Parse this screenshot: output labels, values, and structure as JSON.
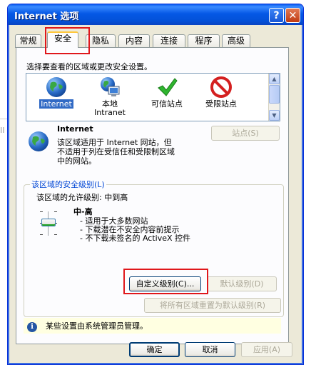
{
  "window": {
    "title": "Internet 选项"
  },
  "tabs": [
    "常规",
    "安全",
    "隐私",
    "内容",
    "连接",
    "程序",
    "高级"
  ],
  "zones": {
    "prompt": "选择要查看的区域或更改安全设置。",
    "items": [
      {
        "label": "Internet",
        "selected": true
      },
      {
        "label": "本地\nIntranet",
        "selected": false
      },
      {
        "label": "可信站点",
        "selected": false
      },
      {
        "label": "受限站点",
        "selected": false
      }
    ]
  },
  "zone_info": {
    "name": "Internet",
    "description": "该区域适用于 Internet 网站，但\n不适用于列在受信任和受限制区域\n中的网站。",
    "sites_button": "站点(S)"
  },
  "security_level": {
    "group_title": "该区域的安全级别(L)",
    "allowed": "该区域的允许级别: 中到高",
    "level_name": "中-高",
    "bullets": [
      "- 适用于大多数网站",
      "- 下载潜在不安全内容前提示",
      "- 不下载未签名的 ActiveX 控件"
    ],
    "custom_button": "自定义级别(C)...",
    "default_button": "默认级别(D)",
    "reset_all_button": "将所有区域重置为默认级别(R)"
  },
  "admin_notice": "某些设置由系统管理员管理。",
  "footer": {
    "ok": "确定",
    "cancel": "取消",
    "apply": "应用(A)"
  },
  "colors": {
    "accent": "#0558e6",
    "highlight_box": "#e0171b",
    "selection": "#316ac5"
  }
}
